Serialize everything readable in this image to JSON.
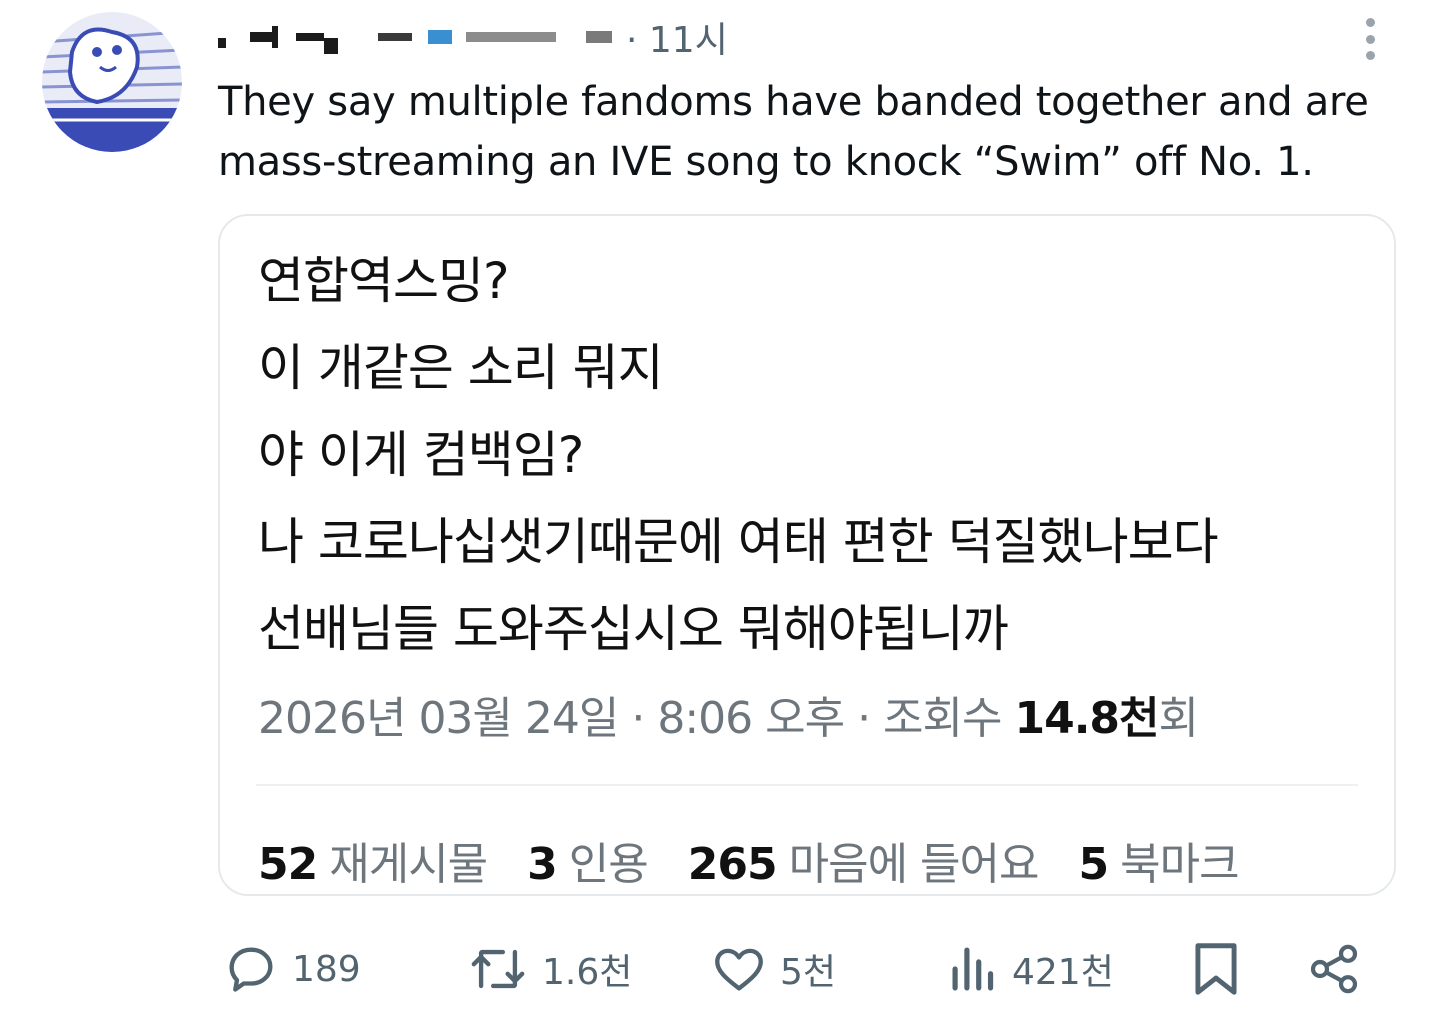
{
  "post": {
    "time": "· 11시",
    "text_lines": [
      "They say multiple fandoms have banded together and are",
      "mass-streaming an IVE song to knock “Swim” off No. 1."
    ]
  },
  "quoted": {
    "lines": [
      "연합역스밍?",
      "이 개같은 소리 뭐지",
      "야 이게 컴백임?",
      "나 코로나십샛기때문에 여태 편한 덕질했나보다",
      "선배님들 도와주십시오 뭐해야됩니까"
    ],
    "meta_prefix": "2026년 03월 24일 · 8:06 오후 · 조회수 ",
    "views_value": "14.8천",
    "views_suffix": "회",
    "stats": [
      {
        "count": "52",
        "label": "재게시물"
      },
      {
        "count": "3",
        "label": "인용"
      },
      {
        "count": "265",
        "label": "마음에 들어요"
      },
      {
        "count": "5",
        "label": "북마크"
      }
    ]
  },
  "actions": {
    "replies": "189",
    "reposts": "1.6천",
    "likes": "5천",
    "views": "421천"
  },
  "colors": {
    "text": "#0f1419",
    "muted": "#536471",
    "avatar_blue": "#3b4bb5",
    "border": "#e6e9ec"
  }
}
